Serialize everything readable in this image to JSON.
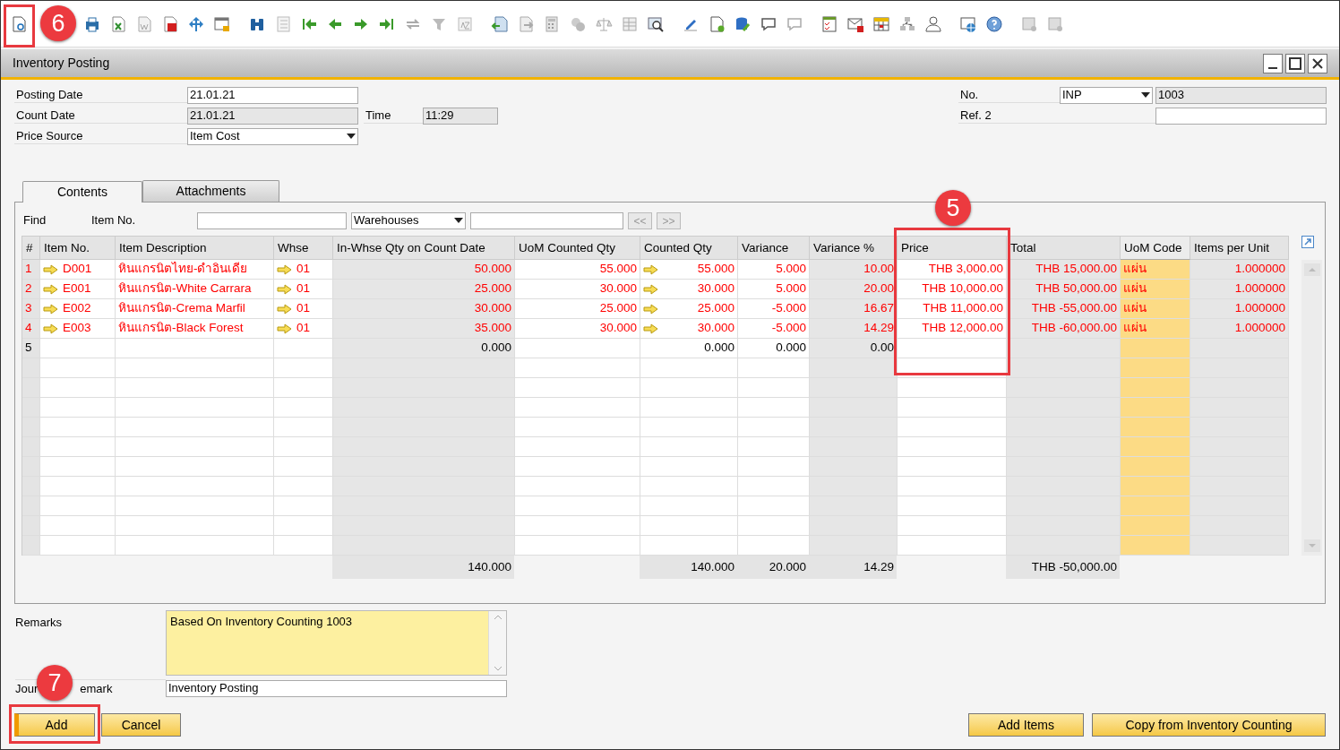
{
  "window": {
    "title": "Inventory Posting"
  },
  "header": {
    "posting_date": {
      "label": "Posting Date",
      "value": "21.01.21"
    },
    "count_date": {
      "label": "Count Date",
      "value": "21.01.21"
    },
    "time": {
      "label": "Time",
      "value": "11:29"
    },
    "price_source": {
      "label": "Price Source",
      "value": "Item Cost"
    },
    "no": {
      "label": "No.",
      "series": "INP",
      "value": "1003"
    },
    "ref2": {
      "label": "Ref. 2"
    }
  },
  "tabs": [
    {
      "label": "Contents",
      "selected": true
    },
    {
      "label": "Attachments",
      "selected": false
    }
  ],
  "find": {
    "label": "Find",
    "field_label": "Item No.",
    "dropdown": "Warehouses",
    "prev": "<<",
    "next": ">>"
  },
  "table": {
    "columns": [
      {
        "label": "#",
        "kind": "index"
      },
      {
        "label": "Item No.",
        "kind": "link"
      },
      {
        "label": "Item Description",
        "kind": "text"
      },
      {
        "label": "Whse",
        "kind": "link"
      },
      {
        "label": "In-Whse Qty on Count Date",
        "kind": "readonly",
        "total": "140.000"
      },
      {
        "label": "UoM Counted Qty",
        "kind": "number"
      },
      {
        "label": "Counted Qty",
        "kind": "link-number",
        "total": "140.000"
      },
      {
        "label": "Variance",
        "kind": "number",
        "total": "20.000"
      },
      {
        "label": "Variance %",
        "kind": "readonly",
        "total": "14.29"
      },
      {
        "label": "Price",
        "kind": "number"
      },
      {
        "label": "Total",
        "kind": "readonly",
        "total": "THB -50,000.00"
      },
      {
        "label": "UoM Code",
        "kind": "uom"
      },
      {
        "label": "Items per Unit",
        "kind": "readonly"
      }
    ],
    "rows": [
      {
        "flagged": true,
        "cells": [
          "1",
          "D001",
          "หินแกรนิตไทย-ดำอินเดีย",
          "01",
          "50.000",
          "55.000",
          "55.000",
          "5.000",
          "10.00",
          "THB 3,000.00",
          "THB 15,000.00",
          "แผ่น",
          "1.000000"
        ]
      },
      {
        "flagged": true,
        "cells": [
          "2",
          "E001",
          "หินแกรนิต-White Carrara",
          "01",
          "25.000",
          "30.000",
          "30.000",
          "5.000",
          "20.00",
          "THB 10,000.00",
          "THB 50,000.00",
          "แผ่น",
          "1.000000"
        ]
      },
      {
        "flagged": true,
        "cells": [
          "3",
          "E002",
          "หินแกรนิต-Crema Marfil",
          "01",
          "30.000",
          "25.000",
          "25.000",
          "-5.000",
          "16.67",
          "THB 11,000.00",
          "THB -55,000.00",
          "แผ่น",
          "1.000000"
        ]
      },
      {
        "flagged": true,
        "cells": [
          "4",
          "E003",
          "หินแกรนิต-Black Forest",
          "01",
          "35.000",
          "30.000",
          "30.000",
          "-5.000",
          "14.29",
          "THB 12,000.00",
          "THB -60,000.00",
          "แผ่น",
          "1.000000"
        ]
      },
      {
        "flagged": false,
        "cells": [
          "5",
          null,
          null,
          null,
          "0.000",
          null,
          "0.000",
          "0.000",
          "0.00",
          null,
          null,
          null,
          null
        ]
      }
    ]
  },
  "remarks": {
    "label": "Remarks",
    "value": "Based On Inventory Counting 1003"
  },
  "journal_remark": {
    "label_parts": [
      "Jour",
      "emark"
    ],
    "value": "Inventory Posting"
  },
  "buttons": {
    "add": "Add",
    "cancel": "Cancel",
    "add_items": "Add Items",
    "copy": "Copy from Inventory Counting"
  },
  "annotations": [
    {
      "label": "6"
    },
    {
      "label": "5"
    },
    {
      "label": "7"
    }
  ]
}
